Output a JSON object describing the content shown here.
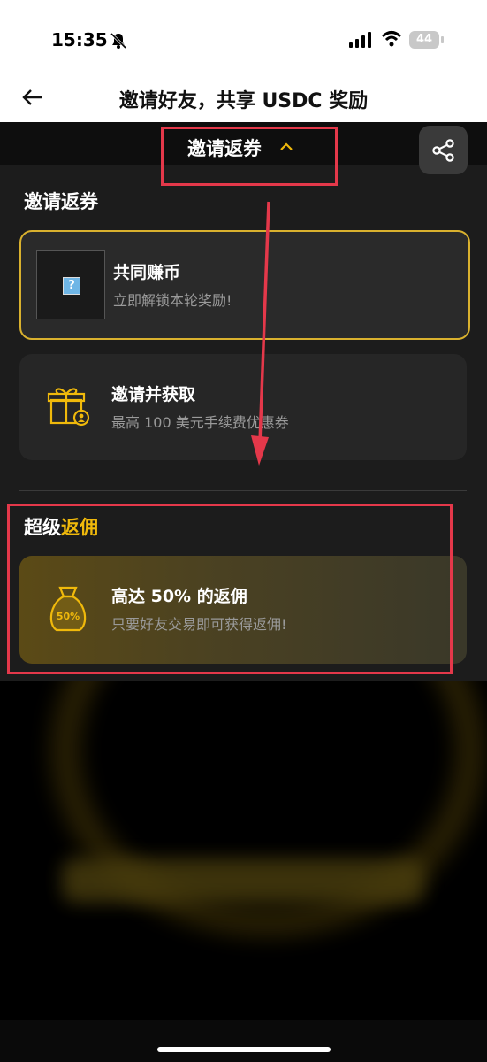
{
  "status_bar": {
    "time": "15:35",
    "battery": "44"
  },
  "header": {
    "title": "邀请好友，共享 USDC 奖励"
  },
  "tab_bar": {
    "label": "邀请返券"
  },
  "section_coupon": {
    "title": "邀请返券",
    "cards": [
      {
        "title": "共同赚币",
        "subtitle": "立即解锁本轮奖励!"
      },
      {
        "title": "邀请并获取",
        "subtitle": "最高 100 美元手续费优惠券"
      }
    ]
  },
  "section_rebate": {
    "title_prefix": "超级",
    "title_highlight": "返佣",
    "card": {
      "title": "高达 50% 的返佣",
      "subtitle": "只要好友交易即可获得返佣!",
      "icon_text": "50%"
    }
  },
  "colors": {
    "accent": "#f0b90b",
    "annotation": "#e4384a",
    "panel_bg": "#1c1c1c"
  }
}
